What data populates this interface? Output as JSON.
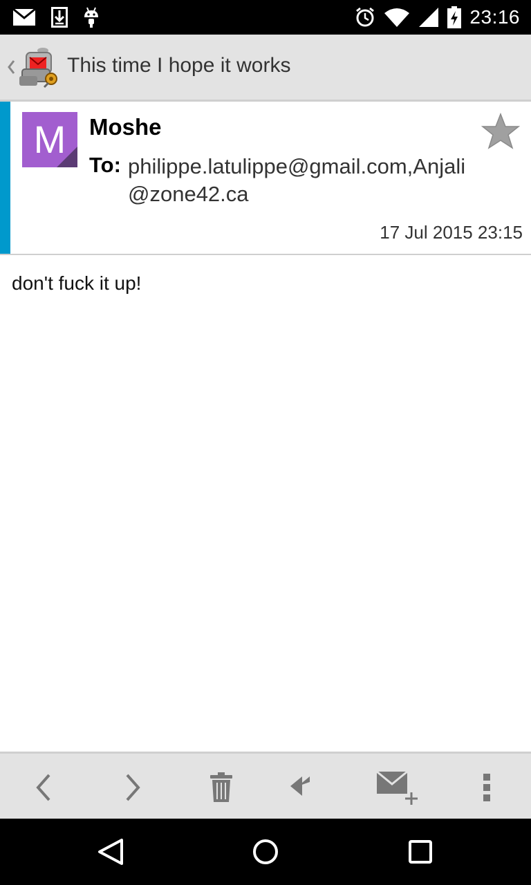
{
  "status_bar": {
    "time": "23:16",
    "left_icons": [
      "gmail-icon",
      "download-icon",
      "android-icon"
    ],
    "right_icons": [
      "alarm-icon",
      "wifi-icon",
      "signal-icon",
      "battery-charging-icon"
    ]
  },
  "action_bar": {
    "title": "This time I hope it works",
    "logo_icon": "k9-mail-logo-icon",
    "back_icon": "chevron-left-icon"
  },
  "message": {
    "avatar_letter": "M",
    "sender": "Moshe",
    "to_label": "To:",
    "to_value": "philippe.latulippe@gmail.com,Anjali@zone42.ca",
    "date": "17 Jul 2015 23:15",
    "starred": false,
    "body": "don't fuck it up!"
  },
  "colors": {
    "unread_bar": "#0099cc",
    "avatar_bg": "#a25ecf",
    "avatar_fold": "#5b3b74",
    "toolbar_icon": "#777777",
    "star": "#a0a0a0"
  },
  "toolbar": {
    "buttons": [
      "previous-icon",
      "next-icon",
      "delete-icon",
      "reply-all-icon",
      "compose-icon",
      "overflow-menu-icon"
    ]
  },
  "nav_bar": {
    "buttons": [
      "back-triangle-icon",
      "home-circle-icon",
      "recents-square-icon"
    ]
  }
}
